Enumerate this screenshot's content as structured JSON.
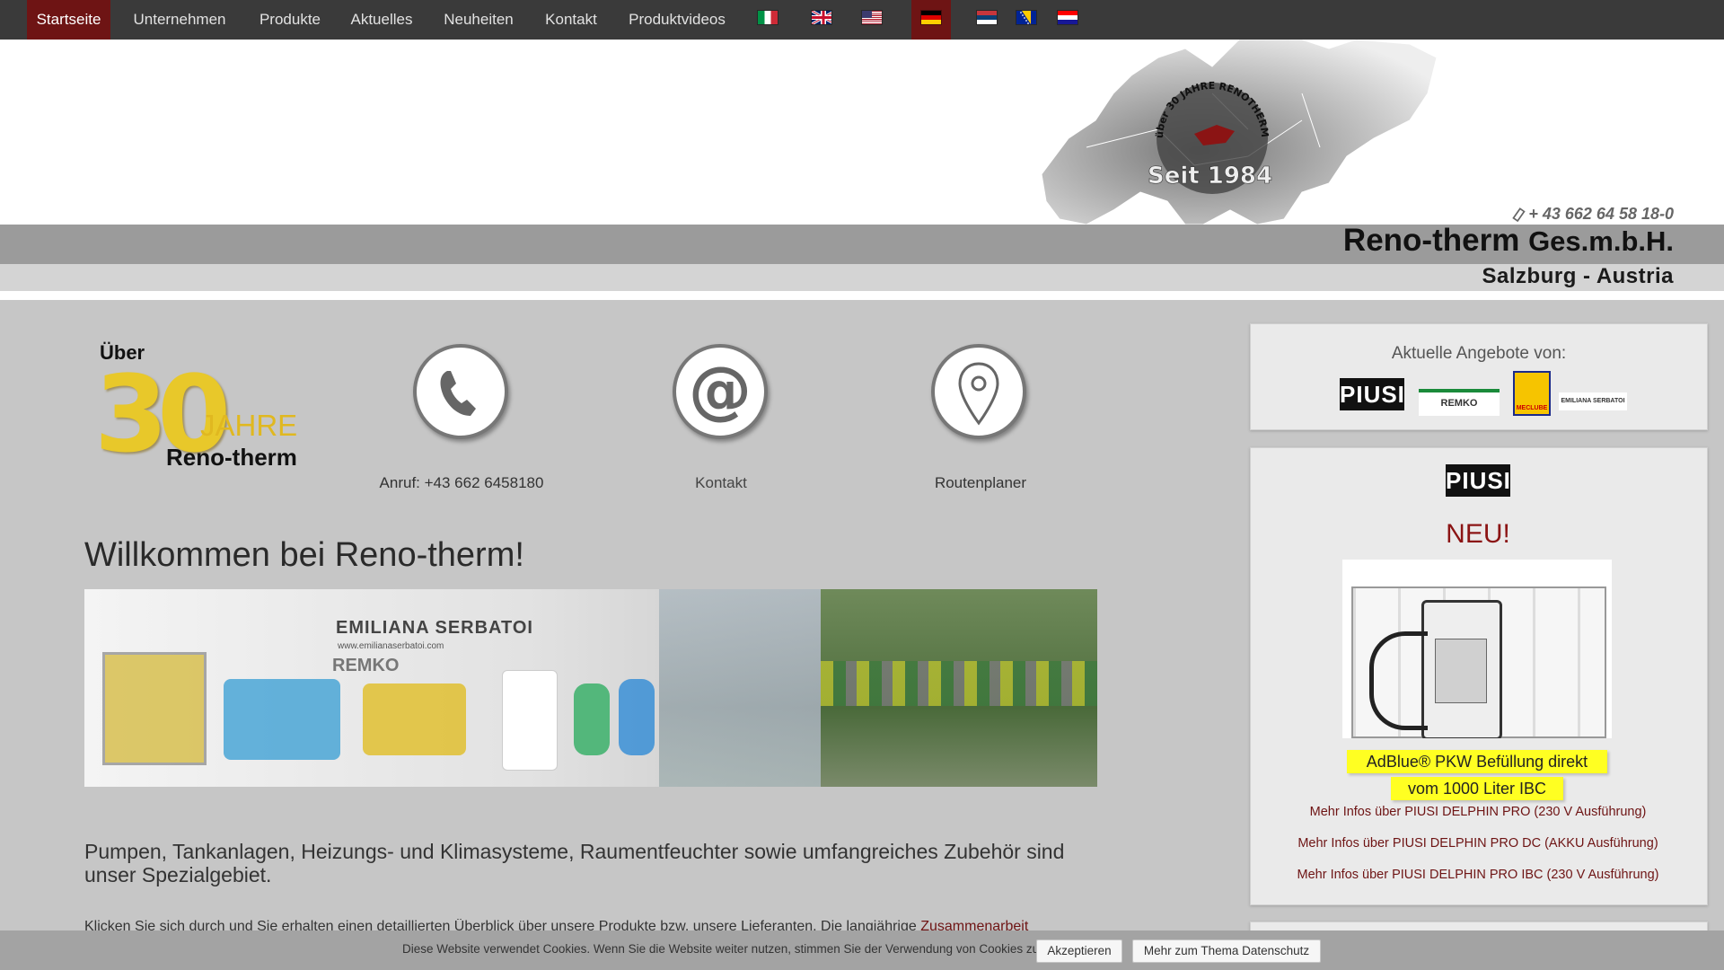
{
  "nav": {
    "items": [
      "Startseite",
      "Unternehmen",
      "Produkte",
      "Aktuelles",
      "Neuheiten",
      "Kontakt",
      "Produktvideos"
    ],
    "active_index": 0,
    "flags": [
      "italy-flag",
      "uk-flag",
      "usa-flag",
      "germany-flag",
      "serbia-flag",
      "bosnia-flag",
      "croatia-flag"
    ],
    "active_flag": "germany-flag"
  },
  "header": {
    "map_text_top": "über 30 JAHRE RENOTHERM Salzburg",
    "map_text_since": "Seit 1984",
    "phone": "+ 43 662 64 58 18-0",
    "company_name": "Reno-therm",
    "company_suffix": "Ges.m.b.H.",
    "location": "Salzburg - Austria"
  },
  "badge": {
    "top": "Über",
    "number": "30",
    "jahre": "JAHRE",
    "name": "Reno-therm"
  },
  "quicklinks": [
    {
      "icon": "phone-icon",
      "label": "Anruf: +43 662 6458180"
    },
    {
      "icon": "at-icon",
      "label": "Kontakt"
    },
    {
      "icon": "location-pin-icon",
      "label": "Routenplaner"
    }
  ],
  "main": {
    "title": "Willkommen bei Reno-therm!",
    "banner_brands": [
      "EMILIANA SERBATOI",
      "www.emilianaserbatoi.com",
      "REMKO"
    ],
    "lead": "Pumpen, Tankanlagen, Heizungs- und Klimasysteme, Raumentfeuchter sowie umfangreiches Zubehör sind unser Spezialgebiet.",
    "paragraph_start": "Klicken Sie sich durch und Sie erhalten einen detaillierten Überblick über unsere Produkte bzw. unsere Lieferanten. Die langjährige ",
    "paragraph_link": "Zusammenarbeit"
  },
  "sidebar": {
    "offers_title": "Aktuelle Angebote von:",
    "offer_logos": [
      "PIUSI",
      "REMKO",
      "MECLUBE",
      "EMILIANA SERBATOI"
    ],
    "promo_brand": "PIUSI",
    "promo_new": "NEU!",
    "promo_line1": "AdBlue® PKW Befüllung direkt",
    "promo_line2": "vom 1000 Liter IBC",
    "links": [
      "Mehr Infos über PIUSI DELPHIN PRO (230 V Ausführung)",
      "Mehr Infos über PIUSI DELPHIN PRO DC (AKKU Ausführung)",
      "Mehr Infos über PIUSI DELPHIN PRO IBC (230 V Ausführung)"
    ]
  },
  "cookie": {
    "text": "Diese Website verwendet Cookies. Wenn Sie die Website weiter nutzen, stimmen Sie der Verwendung von Cookies zu.",
    "accept": "Akzeptieren",
    "more": "Mehr zum Thema Datenschutz"
  },
  "colors": {
    "nav_bg": "#3a3a3a",
    "accent": "#6e1414",
    "highlight": "#ffff22",
    "page_bg": "#c6c6c6"
  }
}
